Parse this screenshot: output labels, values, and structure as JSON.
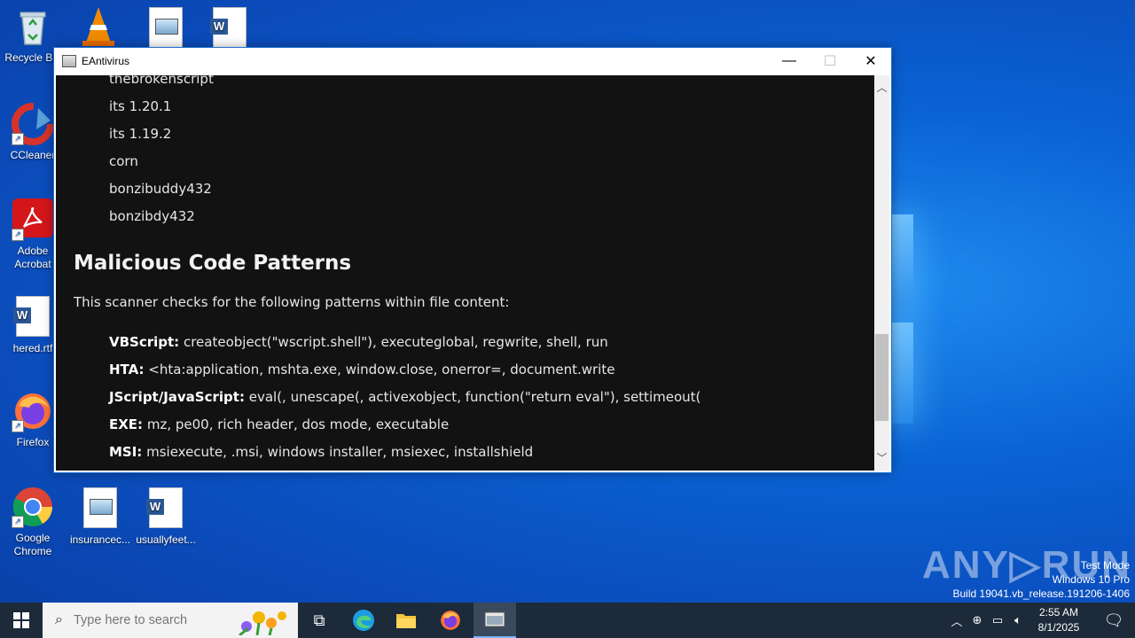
{
  "desktop": {
    "icons": [
      {
        "label": "Recycle Bin"
      },
      {
        "label": "CCleaner"
      },
      {
        "label": "Adobe Acrobat"
      },
      {
        "label": "hered.rtf"
      },
      {
        "label": "Firefox"
      },
      {
        "label": "Google Chrome"
      },
      {
        "label": "insurancec..."
      },
      {
        "label": "usuallyfeet..."
      }
    ]
  },
  "window": {
    "title": "EAntivirus",
    "minimize_glyph": "—",
    "maximize_glyph": "☐",
    "close_glyph": "✕",
    "names_list": [
      "thebrokenscript",
      "its 1.20.1",
      "its 1.19.2",
      "corn",
      "bonzibuddy432",
      "bonzibdy432"
    ],
    "section_heading": "Malicious Code Patterns",
    "intro_text": "This scanner checks for the following patterns within file content:",
    "patterns": [
      {
        "label": "VBScript:",
        "text": "createobject(\"wscript.shell\"), executeglobal, regwrite, shell, run"
      },
      {
        "label": "HTA:",
        "text": "<hta:application, mshta.exe, window.close, onerror=, document.write"
      },
      {
        "label": "JScript/JavaScript:",
        "text": "eval(, unescape(, activexobject, function(\"return eval\"), settimeout("
      },
      {
        "label": "EXE:",
        "text": "mz, pe00, rich header, dos mode, executable"
      },
      {
        "label": "MSI:",
        "text": "msiexecute, .msi, windows installer, msiexec, installshield"
      }
    ]
  },
  "taskbar": {
    "search_placeholder": "Type here to search",
    "time": "2:55 AM",
    "date": "8/1/2025"
  },
  "watermark": {
    "line1": "Test Mode",
    "line2": "Windows 10 Pro",
    "line3": "Build 19041.vb_release.191206-1406",
    "brand": "ANY RUN"
  }
}
